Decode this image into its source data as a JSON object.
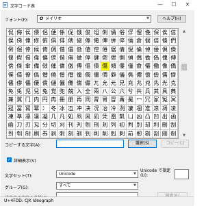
{
  "window": {
    "title": "文字コード表",
    "minimize_glyph": "—",
    "maximize_glyph": "☐",
    "close_glyph": "✕"
  },
  "font": {
    "label": "フォント(F):",
    "value": "メイリオ",
    "font_type_glyph": "O",
    "help_label": "ヘルプ(H)"
  },
  "grid": {
    "rows": [
      "侃侮侯侵侶便係促俄俊俎俐俑俗俘俚俛保俟信",
      "俣俤俥修俯俱俳俵俶俸俺俾倂倅倆倉個倍倏們",
      "倒倔倖候倚倜借倡倣値倥倦倨倩倪倫倬倭倶倹",
      "偃假偈偉偏偐偕偖做停健偬偲側偵偶偸偽傀傅",
      "傍傑傘備傚催傭傲傳傴債傷傾僂僅僉僊働像僑",
      "僕僖僚僞僣僥僧僭僮僴僵價僻儀儁儂億儉儒儕",
      "儘儚儡優償儲儷儺儻儼兀允元兄充兆兇先光克",
      "免兎児兒兔党兜兢入全兩八公六兮共兵其具典",
      "兼冀冂内円冉冊册再冏冐冑冒冓冕冖冗冢冤冥",
      "冦冨冩冪冫冬冰冱冲决况冶冷冽凄凅准凉凋凌",
      "凍凖凛凜凝几凡処凧凩凪凭凰凱凵凶凸凹出函",
      "凾刀刃刄分切刈刊刋刎刑刔列初判別刧利刪刮",
      "到刳制刷券刹刺刻剃剄則削剋剌前剏剔剖剛剞"
    ],
    "selected": {
      "row": 4,
      "col": 11
    }
  },
  "copy": {
    "label": "コピーする文字(A):",
    "value": "",
    "select_label": "選択(S)",
    "copy_label": "コピー(C)"
  },
  "advanced": {
    "label": "詳細表示(V)",
    "checked": true
  },
  "charset": {
    "label": "文字セット(T):",
    "value": "Unicode",
    "jump_label": "Unicode で指定(U):",
    "jump_value": ""
  },
  "group": {
    "label": "グループ(G):",
    "value": "すべて"
  },
  "search": {
    "label": "検索する文字の名前(E):",
    "value": "",
    "button_label": "検索(R)"
  },
  "status": {
    "text": "U+4FDD: CJK Ideograph"
  }
}
